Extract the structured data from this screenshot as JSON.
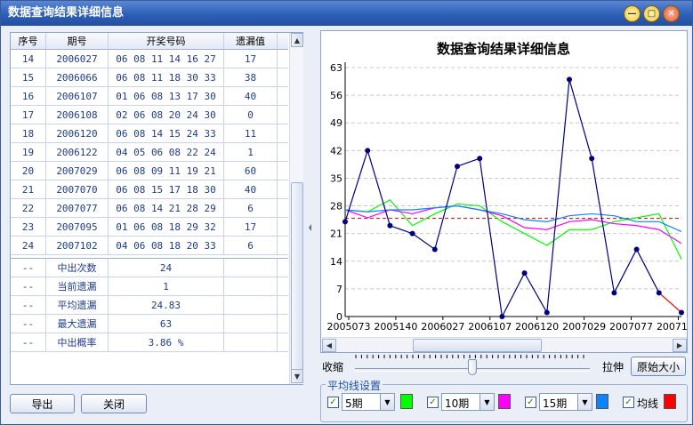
{
  "window": {
    "title": "数据查询结果详细信息"
  },
  "table": {
    "headers": [
      "序号",
      "期号",
      "开奖号码",
      "遗漏值"
    ],
    "rows": [
      {
        "idx": "14",
        "period": "2006027",
        "numbers": "06 08 11 14 16 27",
        "miss": "17"
      },
      {
        "idx": "15",
        "period": "2006066",
        "numbers": "06 08 11 18 30 33",
        "miss": "38"
      },
      {
        "idx": "16",
        "period": "2006107",
        "numbers": "01 06 08 13 17 30",
        "miss": "40"
      },
      {
        "idx": "17",
        "period": "2006108",
        "numbers": "02 06 08 20 24 30",
        "miss": "0"
      },
      {
        "idx": "18",
        "period": "2006120",
        "numbers": "06 08 14 15 24 33",
        "miss": "11"
      },
      {
        "idx": "19",
        "period": "2006122",
        "numbers": "04 05 06 08 22 24",
        "miss": "1"
      },
      {
        "idx": "20",
        "period": "2007029",
        "numbers": "06 08 09 11 19 21",
        "miss": "60"
      },
      {
        "idx": "21",
        "period": "2007070",
        "numbers": "06 08 15 17 18 30",
        "miss": "40"
      },
      {
        "idx": "22",
        "period": "2007077",
        "numbers": "06 08 14 21 28 29",
        "miss": "6"
      },
      {
        "idx": "23",
        "period": "2007095",
        "numbers": "01 06 08 18 29 32",
        "miss": "17"
      },
      {
        "idx": "24",
        "period": "2007102",
        "numbers": "04 06 08 18 20 33",
        "miss": "6"
      }
    ],
    "summary": [
      {
        "idx": "--",
        "label": "中出次数",
        "value": "24"
      },
      {
        "idx": "--",
        "label": "当前遗漏",
        "value": "1"
      },
      {
        "idx": "--",
        "label": "平均遗漏",
        "value": "24.83"
      },
      {
        "idx": "--",
        "label": "最大遗漏",
        "value": "63"
      },
      {
        "idx": "--",
        "label": "中出概率",
        "value": "3.86 %"
      }
    ]
  },
  "buttons": {
    "export": "导出",
    "close": "关闭",
    "original_size": "原始大小"
  },
  "zoom": {
    "shrink_label": "收缩",
    "stretch_label": "拉伸",
    "level": 0.5
  },
  "ma_settings": {
    "title": "平均线设置",
    "items": [
      {
        "period": "5期",
        "checked": true,
        "color": "#00ff00"
      },
      {
        "period": "10期",
        "checked": true,
        "color": "#ff00ff"
      },
      {
        "period": "15期",
        "checked": true,
        "color": "#0a84ff"
      },
      {
        "period": "均线",
        "checked": true,
        "color": "#ff0000"
      }
    ]
  },
  "chart_data": {
    "type": "line",
    "title": "数据查询结果详细信息",
    "ylim": [
      0,
      63
    ],
    "yticks": [
      0,
      7,
      14,
      21,
      28,
      35,
      42,
      49,
      56,
      63
    ],
    "xtick_labels": [
      "2005073",
      "2005140",
      "2006027",
      "2006107",
      "2006120",
      "2007029",
      "2007077",
      "2007102"
    ],
    "grid": true,
    "average_line": 24.83,
    "series": [
      {
        "color": "#000080",
        "values": [
          24,
          42,
          23,
          21,
          17,
          38,
          40,
          0,
          11,
          1,
          60,
          40,
          6,
          17,
          6,
          1
        ]
      },
      {
        "color": "#00ff00",
        "values": [
          27,
          26.5,
          29.5,
          23,
          26,
          28.5,
          28,
          24,
          21,
          18,
          22,
          22,
          24,
          25,
          26,
          14.5
        ]
      },
      {
        "color": "#ff00ff",
        "values": [
          27,
          25,
          27,
          26,
          27.5,
          28,
          27,
          25.5,
          22.5,
          22,
          24,
          24.5,
          23.5,
          23,
          22,
          18.5
        ]
      },
      {
        "color": "#0a84ff",
        "values": [
          27,
          26.5,
          27,
          27,
          27.5,
          28,
          27,
          26,
          24.5,
          24,
          25.5,
          26,
          25.5,
          24,
          24,
          21.5
        ]
      }
    ]
  }
}
